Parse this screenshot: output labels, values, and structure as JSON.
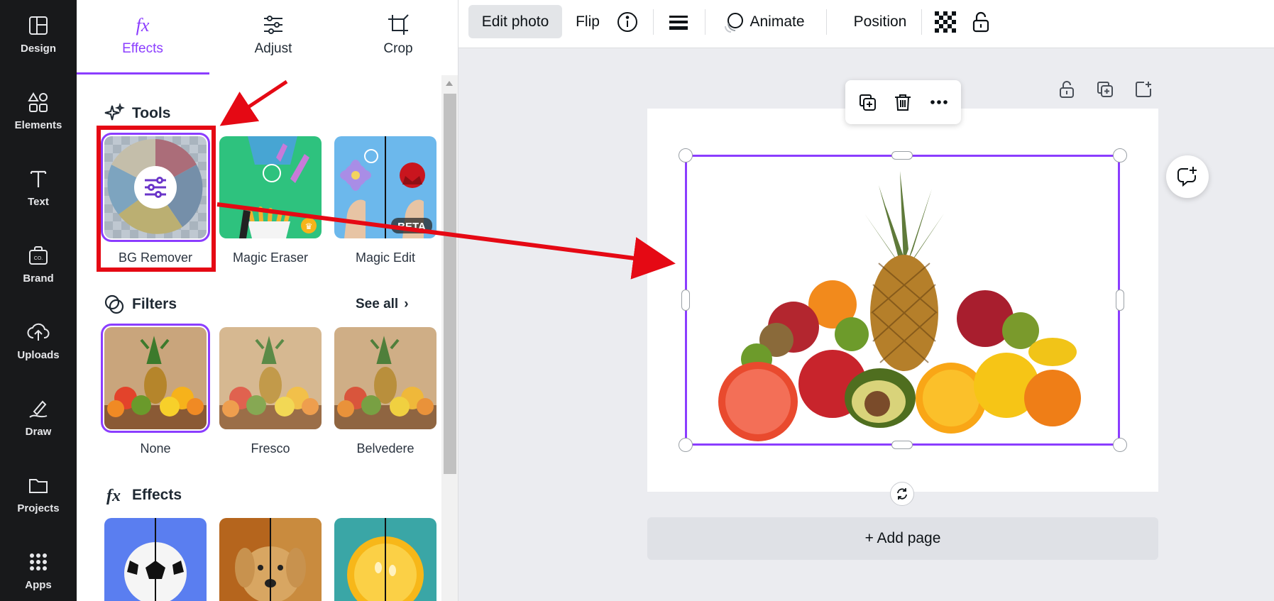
{
  "colors": {
    "accent": "#8b3dff",
    "annotation": "#e50914",
    "rail_bg": "#18191b"
  },
  "rail": {
    "items": [
      {
        "label": "Design",
        "icon": "layout-icon"
      },
      {
        "label": "Elements",
        "icon": "shapes-icon"
      },
      {
        "label": "Text",
        "icon": "text-icon"
      },
      {
        "label": "Brand",
        "icon": "brand-kit-icon"
      },
      {
        "label": "Uploads",
        "icon": "cloud-upload-icon"
      },
      {
        "label": "Draw",
        "icon": "pen-icon"
      },
      {
        "label": "Projects",
        "icon": "folder-icon"
      },
      {
        "label": "Apps",
        "icon": "grid-icon"
      }
    ]
  },
  "panel": {
    "tabs": [
      {
        "label": "Effects",
        "icon": "fx-icon",
        "active": true
      },
      {
        "label": "Adjust",
        "icon": "sliders-icon"
      },
      {
        "label": "Crop",
        "icon": "crop-icon"
      }
    ],
    "tools": {
      "title": "Tools",
      "items": [
        {
          "label": "BG Remover"
        },
        {
          "label": "Magic Eraser"
        },
        {
          "label": "Magic Edit",
          "badge": "BETA"
        }
      ]
    },
    "filters": {
      "title": "Filters",
      "see_all": "See all",
      "items": [
        {
          "label": "None",
          "selected": true
        },
        {
          "label": "Fresco"
        },
        {
          "label": "Belvedere"
        }
      ]
    },
    "effects": {
      "title": "Effects"
    }
  },
  "toolbar": {
    "edit_photo": "Edit photo",
    "flip": "Flip",
    "animate": "Animate",
    "position": "Position"
  },
  "canvas": {
    "add_page": "+ Add page"
  }
}
